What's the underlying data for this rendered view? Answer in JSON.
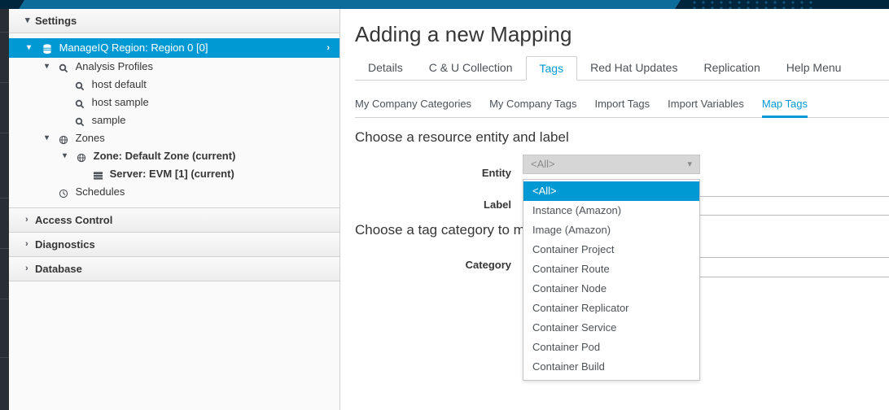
{
  "sidebar": {
    "panels": [
      {
        "label": "Settings",
        "expanded": true,
        "icon": "chevron-down-icon"
      },
      {
        "label": "Access Control",
        "expanded": false,
        "icon": "chevron-right-icon"
      },
      {
        "label": "Diagnostics",
        "expanded": false,
        "icon": "chevron-right-icon"
      },
      {
        "label": "Database",
        "expanded": false,
        "icon": "chevron-right-icon"
      }
    ],
    "tree": [
      {
        "label": "ManageIQ Region: Region 0 [0]",
        "icon": "database-icon",
        "indent": 0,
        "expander": "chevron-down-icon",
        "selected": true,
        "bold": false,
        "arrow": "chevron-right-icon"
      },
      {
        "label": "Analysis Profiles",
        "icon": "magnifier-icon",
        "indent": 1,
        "expander": "chevron-down-icon",
        "selected": false,
        "bold": false
      },
      {
        "label": "host default",
        "icon": "magnifier-icon",
        "indent": 2,
        "expander": "",
        "selected": false,
        "bold": false
      },
      {
        "label": "host sample",
        "icon": "magnifier-icon",
        "indent": 2,
        "expander": "",
        "selected": false,
        "bold": false
      },
      {
        "label": "sample",
        "icon": "magnifier-icon",
        "indent": 2,
        "expander": "",
        "selected": false,
        "bold": false
      },
      {
        "label": "Zones",
        "icon": "zone-globe-icon",
        "indent": 1,
        "expander": "chevron-down-icon",
        "selected": false,
        "bold": false
      },
      {
        "label": "Zone: Default Zone (current)",
        "icon": "zone-globe-icon",
        "indent": 2,
        "expander": "chevron-down-icon",
        "selected": false,
        "bold": true
      },
      {
        "label": "Server: EVM [1] (current)",
        "icon": "server-icon",
        "indent": 3,
        "expander": "",
        "selected": false,
        "bold": true
      },
      {
        "label": "Schedules",
        "icon": "clock-icon",
        "indent": 1,
        "expander": "",
        "selected": false,
        "bold": false
      }
    ]
  },
  "main": {
    "title": "Adding a new Mapping",
    "tabs": [
      {
        "label": "Details",
        "active": false
      },
      {
        "label": "C & U Collection",
        "active": false
      },
      {
        "label": "Tags",
        "active": true
      },
      {
        "label": "Red Hat Updates",
        "active": false
      },
      {
        "label": "Replication",
        "active": false
      },
      {
        "label": "Help Menu",
        "active": false
      }
    ],
    "subtabs": [
      {
        "label": "My Company Categories",
        "active": false
      },
      {
        "label": "My Company Tags",
        "active": false
      },
      {
        "label": "Import Tags",
        "active": false
      },
      {
        "label": "Import Variables",
        "active": false
      },
      {
        "label": "Map Tags",
        "active": true
      }
    ],
    "sections": [
      {
        "heading": "Choose a resource entity and label"
      },
      {
        "heading": "Choose a tag category to m"
      }
    ],
    "fields": {
      "entity_label": "Entity",
      "label_label": "Label",
      "category_label": "Category"
    },
    "entity_select": {
      "value": "<All>",
      "caret": "chevron-down-icon",
      "options": [
        {
          "label": "<All>",
          "selected": true
        },
        {
          "label": "Instance (Amazon)",
          "selected": false
        },
        {
          "label": "Image (Amazon)",
          "selected": false
        },
        {
          "label": "Container Project",
          "selected": false
        },
        {
          "label": "Container Route",
          "selected": false
        },
        {
          "label": "Container Node",
          "selected": false
        },
        {
          "label": "Container Replicator",
          "selected": false
        },
        {
          "label": "Container Service",
          "selected": false
        },
        {
          "label": "Container Pod",
          "selected": false
        },
        {
          "label": "Container Build",
          "selected": false
        }
      ]
    }
  },
  "colors": {
    "accent": "#0099d3",
    "navbar_dark": "#00263e",
    "navbar_blue": "#0e6c9a",
    "rail": "#292e34"
  }
}
